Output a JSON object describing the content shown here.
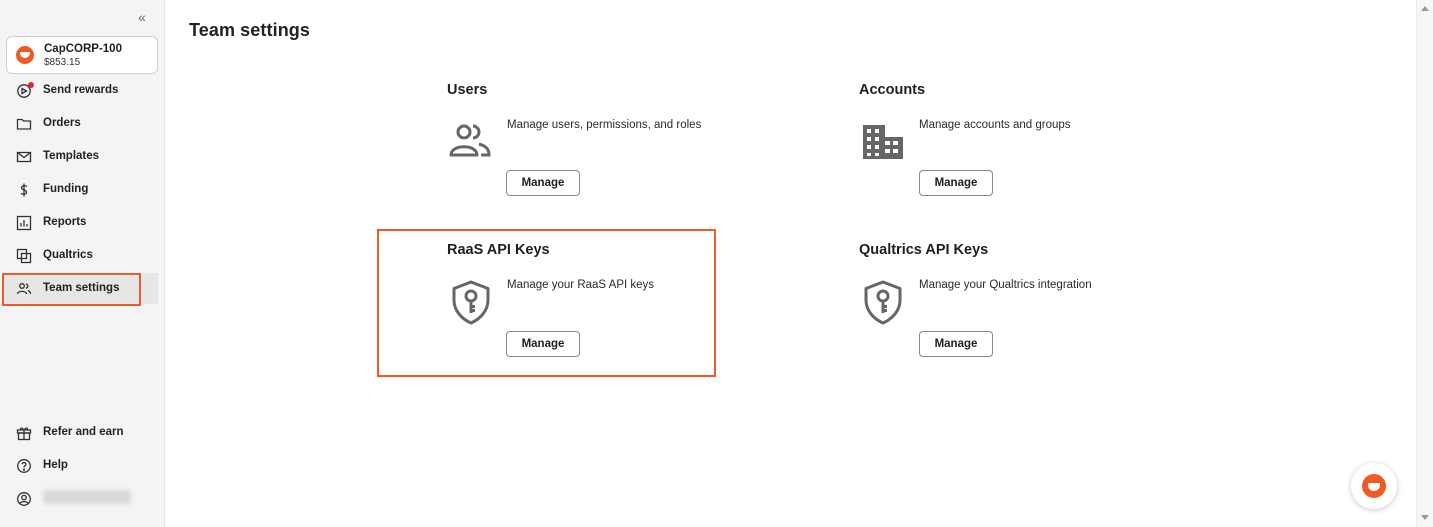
{
  "sidebar": {
    "collapse_icon": "«",
    "account": {
      "name": "CapCORP-100",
      "balance": "$853.15"
    },
    "nav": [
      {
        "label": "Send rewards",
        "icon": "send-rewards-icon"
      },
      {
        "label": "Orders",
        "icon": "folder-icon"
      },
      {
        "label": "Templates",
        "icon": "mail-icon"
      },
      {
        "label": "Funding",
        "icon": "dollar-icon"
      },
      {
        "label": "Reports",
        "icon": "chart-icon"
      },
      {
        "label": "Qualtrics",
        "icon": "qualtrics-icon"
      },
      {
        "label": "Team settings",
        "icon": "team-icon",
        "active": true
      }
    ],
    "bottom": [
      {
        "label": "Refer and earn",
        "icon": "gift-icon"
      },
      {
        "label": "Help",
        "icon": "help-icon"
      }
    ]
  },
  "page": {
    "title": "Team settings",
    "cards": [
      {
        "title": "Users",
        "description": "Manage users, permissions, and roles",
        "button": "Manage",
        "icon": "users-icon"
      },
      {
        "title": "Accounts",
        "description": "Manage accounts and groups",
        "button": "Manage",
        "icon": "building-icon"
      },
      {
        "title": "RaaS API Keys",
        "description": "Manage your RaaS API keys",
        "button": "Manage",
        "icon": "shield-key-icon"
      },
      {
        "title": "Qualtrics API Keys",
        "description": "Manage your Qualtrics integration",
        "button": "Manage",
        "icon": "shield-key-icon"
      }
    ]
  },
  "colors": {
    "accent": "#ee5a2b",
    "brand": "#f15a24",
    "notification": "#e0263a"
  }
}
